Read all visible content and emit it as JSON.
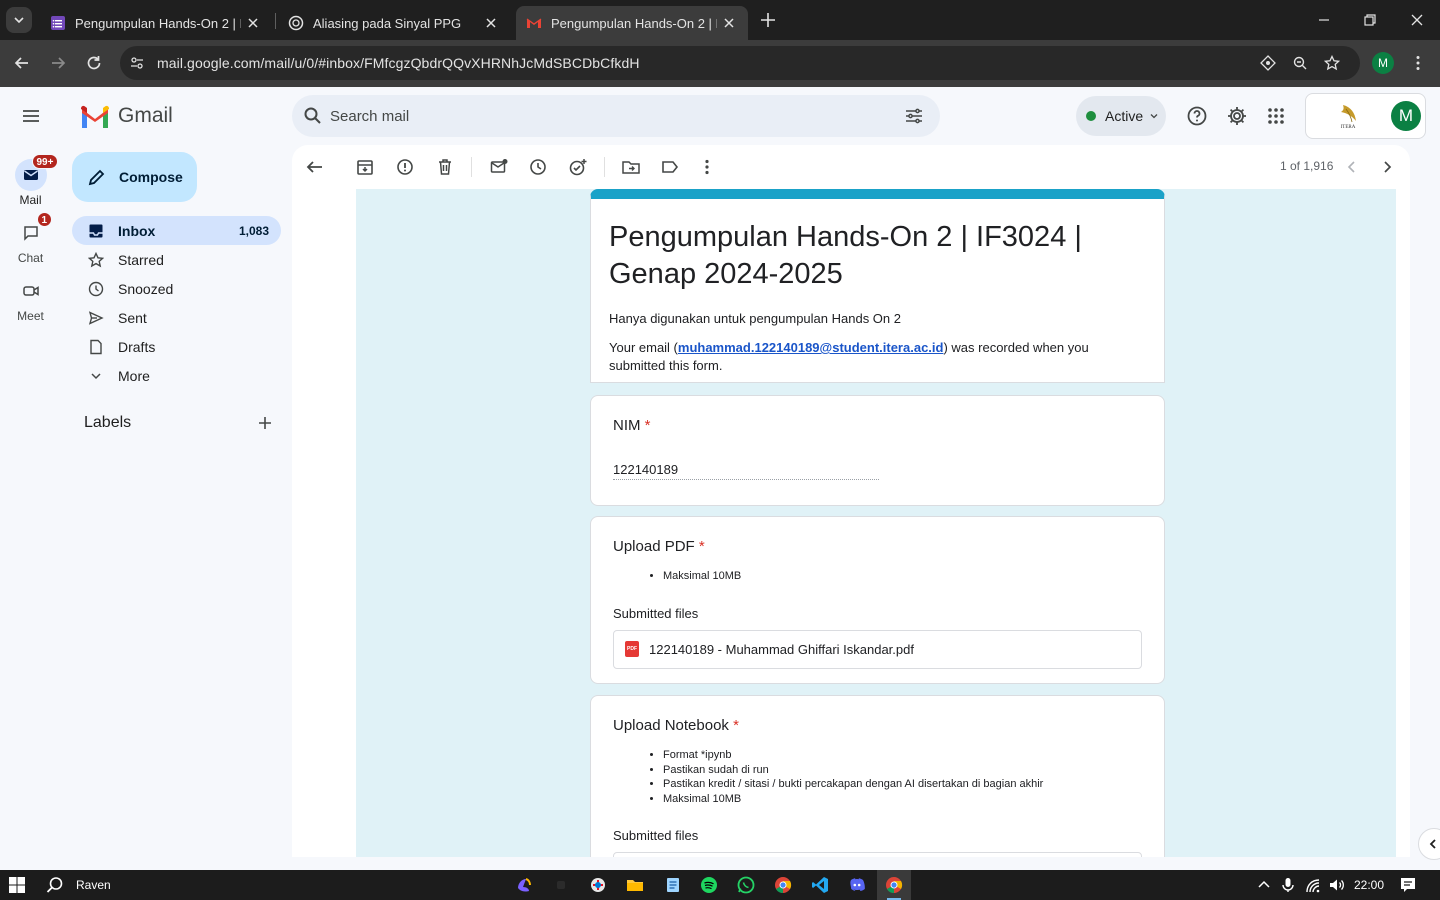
{
  "browser": {
    "tabs": [
      {
        "title": "Pengumpulan Hands-On 2 | IF3024",
        "icon": "google-forms-icon"
      },
      {
        "title": "Aliasing pada Sinyal PPG",
        "icon": "openai-icon"
      },
      {
        "title": "Pengumpulan Hands-On 2 | IF3024",
        "icon": "gmail-icon",
        "active": true
      }
    ],
    "url": "mail.google.com/mail/u/0/#inbox/FMfcgzQbdrQQvXHRNhJcMdSBCDbCfkdH",
    "profile_initial": "M"
  },
  "gmail": {
    "brand": "Gmail",
    "search_placeholder": "Search mail",
    "status": "Active",
    "account_initial": "M",
    "account_logo_text": "ITERA",
    "rail": [
      {
        "label": "Mail",
        "badge": "99+"
      },
      {
        "label": "Chat",
        "badge": "1"
      },
      {
        "label": "Meet",
        "badge": ""
      }
    ],
    "compose_label": "Compose",
    "nav": [
      {
        "label": "Inbox",
        "count": "1,083",
        "icon": "inbox-icon"
      },
      {
        "label": "Starred",
        "count": "",
        "icon": "star-icon"
      },
      {
        "label": "Snoozed",
        "count": "",
        "icon": "clock-icon"
      },
      {
        "label": "Sent",
        "count": "",
        "icon": "send-icon"
      },
      {
        "label": "Drafts",
        "count": "",
        "icon": "draft-icon"
      },
      {
        "label": "More",
        "count": "",
        "icon": "chevron-down-icon"
      }
    ],
    "labels_heading": "Labels",
    "pager": "1 of 1,916"
  },
  "form": {
    "title": "Pengumpulan Hands-On 2 | IF3024 | Genap 2024-2025",
    "description": "Hanya digunakan untuk pengumpulan Hands On 2",
    "email_prefix": "Your email (",
    "email": "muhammad.122140189@student.itera.ac.id",
    "email_suffix": ") was recorded when you submitted this form.",
    "required_mark": "*",
    "q1": {
      "title": "NIM",
      "answer": "122140189"
    },
    "q2": {
      "title": "Upload PDF",
      "bullets": [
        "Maksimal 10MB"
      ],
      "submitted_label": "Submitted files",
      "file": "122140189 - Muhammad Ghiffari Iskandar.pdf"
    },
    "q3": {
      "title": "Upload Notebook",
      "bullets": [
        "Format *ipynb",
        "Pastikan sudah di run",
        "Pastikan kredit / sitasi / bukti percakapan dengan AI disertakan di bagian akhir",
        "Maksimal 10MB"
      ],
      "submitted_label": "Submitted files"
    }
  },
  "taskbar": {
    "search_label": "Raven",
    "time": "22:00"
  },
  "colors": {
    "accent": "#1aa2c8",
    "form_background": "#e0f2f7",
    "selected_nav": "#d3e3fd",
    "compose": "#c2e7ff"
  }
}
